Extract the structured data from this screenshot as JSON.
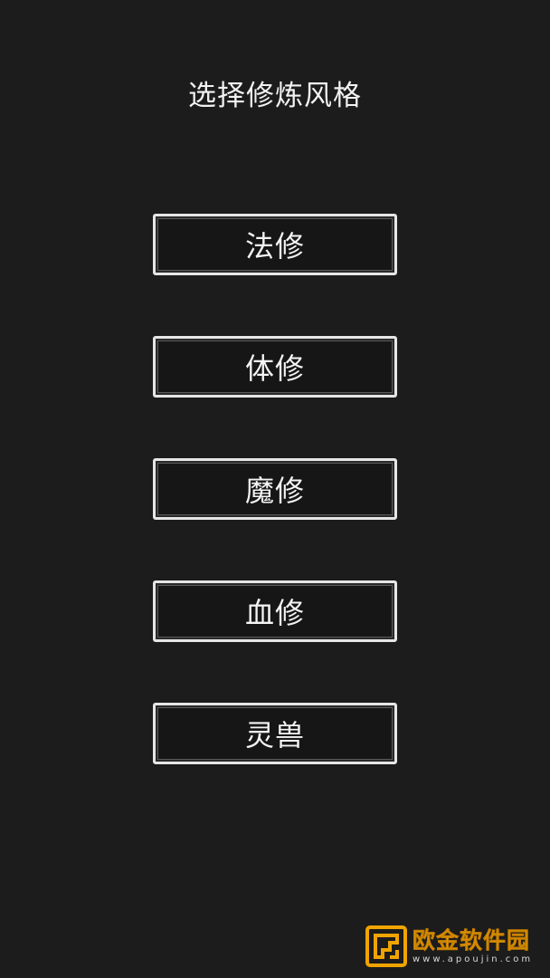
{
  "screen": {
    "title": "选择修炼风格"
  },
  "choices": [
    {
      "label": "法修"
    },
    {
      "label": "体修"
    },
    {
      "label": "魔修"
    },
    {
      "label": "血修"
    },
    {
      "label": "灵兽"
    }
  ],
  "watermark": {
    "name": "欧金软件园",
    "url": "www.apoujin.com",
    "icon": "apoujin-logo-icon"
  },
  "colors": {
    "background": "#1c1c1c",
    "button_border": "#e6e6e6",
    "text": "#f4f4f4",
    "watermark_accent": "#f0a400"
  }
}
